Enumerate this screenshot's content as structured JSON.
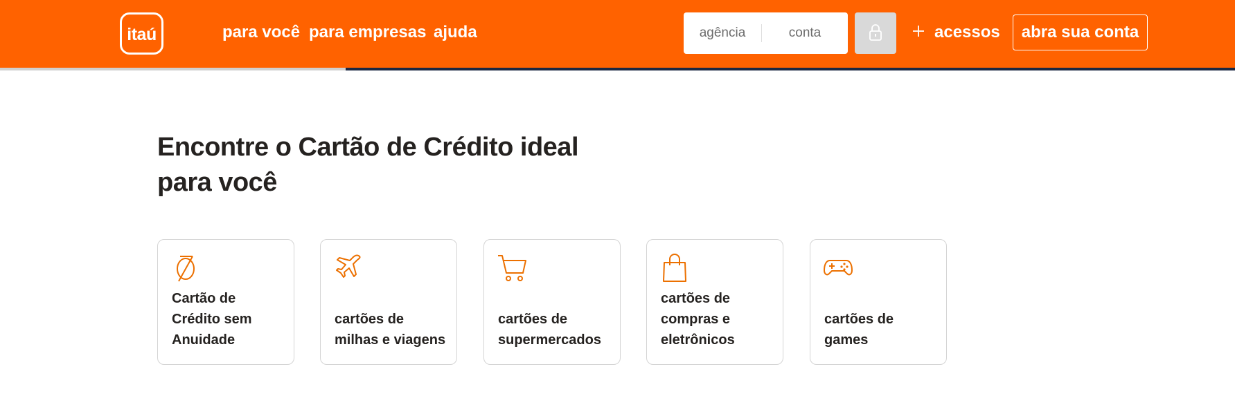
{
  "header": {
    "logo_text": "itaú",
    "nav": [
      "para você",
      "para empresas",
      "ajuda"
    ],
    "login": {
      "agencia_placeholder": "agência",
      "conta_placeholder": "conta"
    },
    "acessos_label": "acessos",
    "abra_label": "abra sua conta",
    "brand_color": "#ff6200"
  },
  "progress": {
    "value_fraction": 0.28,
    "fill_color": "#d0d0d0",
    "track_color": "#1c2843"
  },
  "main": {
    "title_lines": [
      "Encontre o Cartão de Crédito ideal",
      "para você"
    ],
    "cards": [
      {
        "icon": "no-annuity-icon",
        "label_lines": [
          "Cartão de",
          "Crédito sem",
          "Anuidade"
        ]
      },
      {
        "icon": "airplane-icon",
        "label_lines": [
          "cartões de",
          "milhas e viagens"
        ]
      },
      {
        "icon": "shopping-cart-icon",
        "label_lines": [
          "cartões de",
          "supermercados"
        ]
      },
      {
        "icon": "shopping-bag-icon",
        "label_lines": [
          "cartões de",
          "compras e",
          "eletrônicos"
        ]
      },
      {
        "icon": "gamepad-icon",
        "label_lines": [
          "cartões de",
          "games"
        ]
      }
    ]
  }
}
